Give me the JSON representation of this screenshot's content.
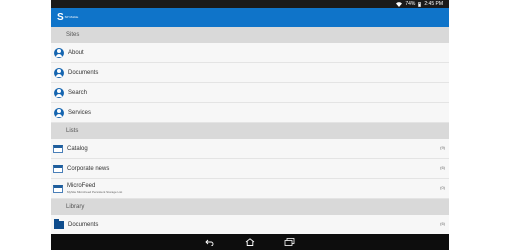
{
  "status_bar": {
    "battery": "74%",
    "time": "2:45 PM"
  },
  "app_bar": {
    "logo_letter": "S",
    "logo_sub": "SP Mobile"
  },
  "sections": {
    "sites": {
      "header": "Sites",
      "items": [
        {
          "label": "About"
        },
        {
          "label": "Documents"
        },
        {
          "label": "Search"
        },
        {
          "label": "Services"
        }
      ]
    },
    "lists": {
      "header": "Lists",
      "items": [
        {
          "label": "Catalog",
          "count": "(9)"
        },
        {
          "label": "Corporate news",
          "count": "(6)"
        },
        {
          "label": "MicroFeed",
          "sub": "MySite MicroFeed Persistent Storage List",
          "count": "(0)"
        }
      ]
    },
    "library": {
      "header": "Library",
      "items": [
        {
          "label": "Documents",
          "count": "(6)"
        }
      ]
    }
  },
  "nav": {
    "back": "back",
    "home": "home",
    "recents": "recents"
  }
}
